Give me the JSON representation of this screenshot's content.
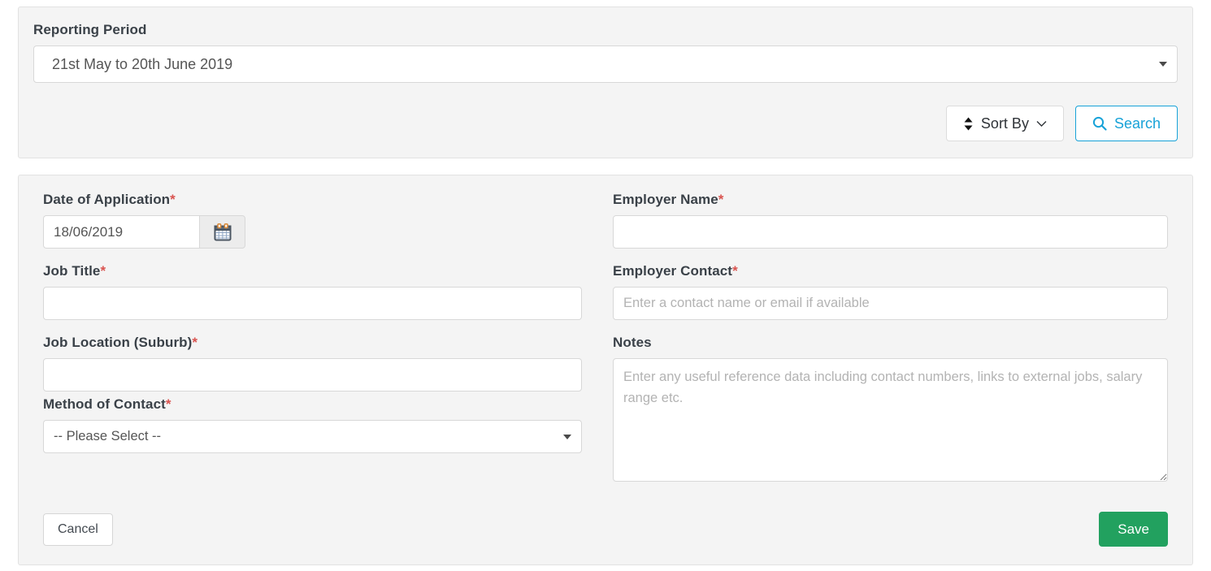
{
  "search_panel": {
    "reporting_period_label": "Reporting Period",
    "reporting_period_value": "21st May to 20th June 2019",
    "sort_by_label": "Sort By",
    "search_label": "Search",
    "sort_icon": "sort-updown-icon",
    "chevron_icon": "chevron-down-icon",
    "search_icon": "search-icon",
    "caret_icon": "caret-down-icon"
  },
  "form": {
    "date_of_application": {
      "label": "Date of Application",
      "required_marker": "*",
      "value": "18/06/2019",
      "calendar_icon": "calendar-icon"
    },
    "job_title": {
      "label": "Job Title",
      "required_marker": "*",
      "value": "",
      "placeholder": ""
    },
    "job_location": {
      "label": "Job Location (Suburb)",
      "required_marker": "*",
      "value": "",
      "placeholder": ""
    },
    "method_of_contact": {
      "label": "Method of Contact",
      "required_marker": "*",
      "value": "-- Please Select --"
    },
    "employer_name": {
      "label": "Employer Name",
      "required_marker": "*",
      "value": "",
      "placeholder": ""
    },
    "employer_contact": {
      "label": "Employer Contact",
      "required_marker": "*",
      "value": "",
      "placeholder": "Enter a contact name or email if available"
    },
    "notes": {
      "label": "Notes",
      "value": "",
      "placeholder": "Enter any useful reference data including contact numbers, links to external jobs, salary range etc."
    },
    "cancel_label": "Cancel",
    "save_label": "Save"
  },
  "colors": {
    "panel_bg": "#f4f4f4",
    "panel_border": "#e2e2e2",
    "label_text": "#3a4148",
    "required_red": "#d9534f",
    "accent_blue": "#17a2d8",
    "save_green": "#22a15f",
    "input_border": "#d8d8d8",
    "placeholder": "#b3b3b3"
  }
}
